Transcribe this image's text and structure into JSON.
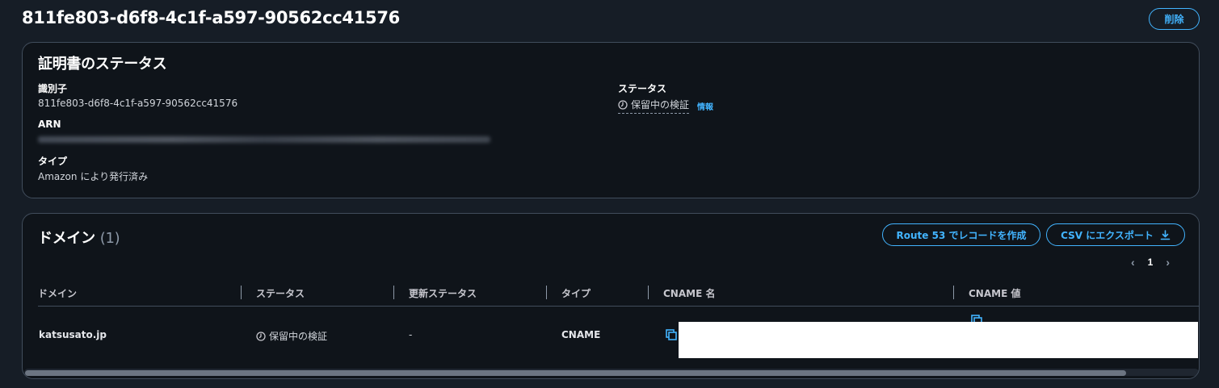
{
  "page": {
    "title": "811fe803-d6f8-4c1f-a597-90562cc41576",
    "delete_label": "削除"
  },
  "status_panel": {
    "title": "証明書のステータス",
    "identifier_label": "識別子",
    "identifier_value": "811fe803-d6f8-4c1f-a597-90562cc41576",
    "arn_label": "ARN",
    "type_label": "タイプ",
    "type_value": "Amazon により発行済み",
    "status_label": "ステータス",
    "status_value": "保留中の検証",
    "info_label": "情報"
  },
  "domain_panel": {
    "title": "ドメイン",
    "count": "(1)",
    "route53_label": "Route 53 でレコードを作成",
    "csv_label": "CSV にエクスポート",
    "page_number": "1",
    "columns": [
      "ドメイン",
      "ステータス",
      "更新ステータス",
      "タイプ",
      "CNAME 名",
      "CNAME 値"
    ],
    "rows": [
      {
        "domain": "katsusato.jp",
        "status": "保留中の検証",
        "renewal_status": "-",
        "type": "CNAME"
      }
    ]
  },
  "colors": {
    "accent": "#42b4ff",
    "background": "#161d26",
    "panel": "#0f141a"
  }
}
